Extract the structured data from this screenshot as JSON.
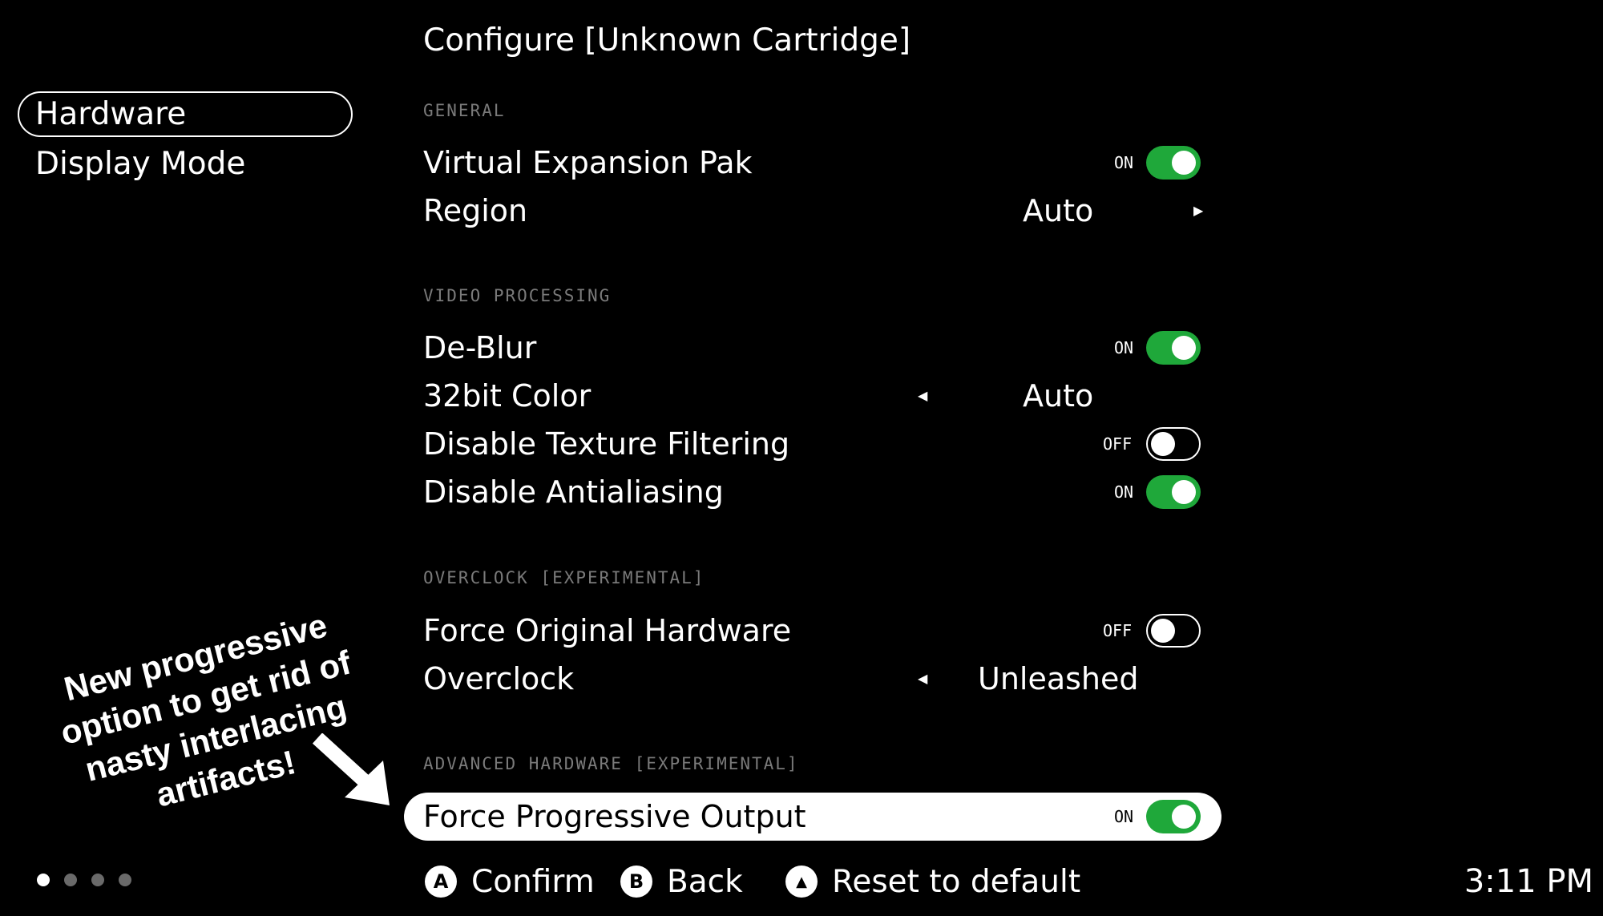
{
  "page": {
    "title": "Configure [Unknown Cartridge]"
  },
  "sidebar": {
    "items": [
      {
        "label": "Hardware",
        "selected": true
      },
      {
        "label": "Display Mode",
        "selected": false
      }
    ]
  },
  "sections": [
    {
      "heading": "GENERAL"
    },
    {
      "heading": "VIDEO PROCESSING"
    },
    {
      "heading": "OVERCLOCK [EXPERIMENTAL]"
    },
    {
      "heading": "ADVANCED HARDWARE [EXPERIMENTAL]"
    }
  ],
  "settings": {
    "virtual_expansion_pak": {
      "label": "Virtual Expansion Pak",
      "state": "ON"
    },
    "region": {
      "label": "Region",
      "value": "Auto"
    },
    "de_blur": {
      "label": "De-Blur",
      "state": "ON"
    },
    "color_32bit": {
      "label": "32bit Color",
      "value": "Auto"
    },
    "disable_texture_filtering": {
      "label": "Disable Texture Filtering",
      "state": "OFF"
    },
    "disable_antialiasing": {
      "label": "Disable Antialiasing",
      "state": "ON"
    },
    "force_original_hardware": {
      "label": "Force Original Hardware",
      "state": "OFF"
    },
    "overclock": {
      "label": "Overclock",
      "value": "Unleashed"
    },
    "force_progressive_output": {
      "label": "Force Progressive Output",
      "state": "ON",
      "selected": true
    }
  },
  "footer": {
    "confirm": {
      "glyph": "A",
      "label": "Confirm"
    },
    "back": {
      "glyph": "B",
      "label": "Back"
    },
    "reset": {
      "glyph": "▲",
      "label": "Reset to default"
    },
    "page_dots": {
      "count": 4,
      "active_index": 0
    },
    "clock": "3:11 PM"
  },
  "annotation": {
    "text": "New progressive option to get rid of nasty interlacing artifacts!"
  },
  "colors": {
    "background": "#000000",
    "toggle_on": "#1fa83a",
    "section_heading": "#7a7a7a",
    "text": "#ffffff"
  },
  "icons": [
    "arrow-right-icon",
    "arrow-left-icon",
    "button-a-icon",
    "button-b-icon",
    "button-triangle-icon",
    "annotation-arrow-icon"
  ]
}
